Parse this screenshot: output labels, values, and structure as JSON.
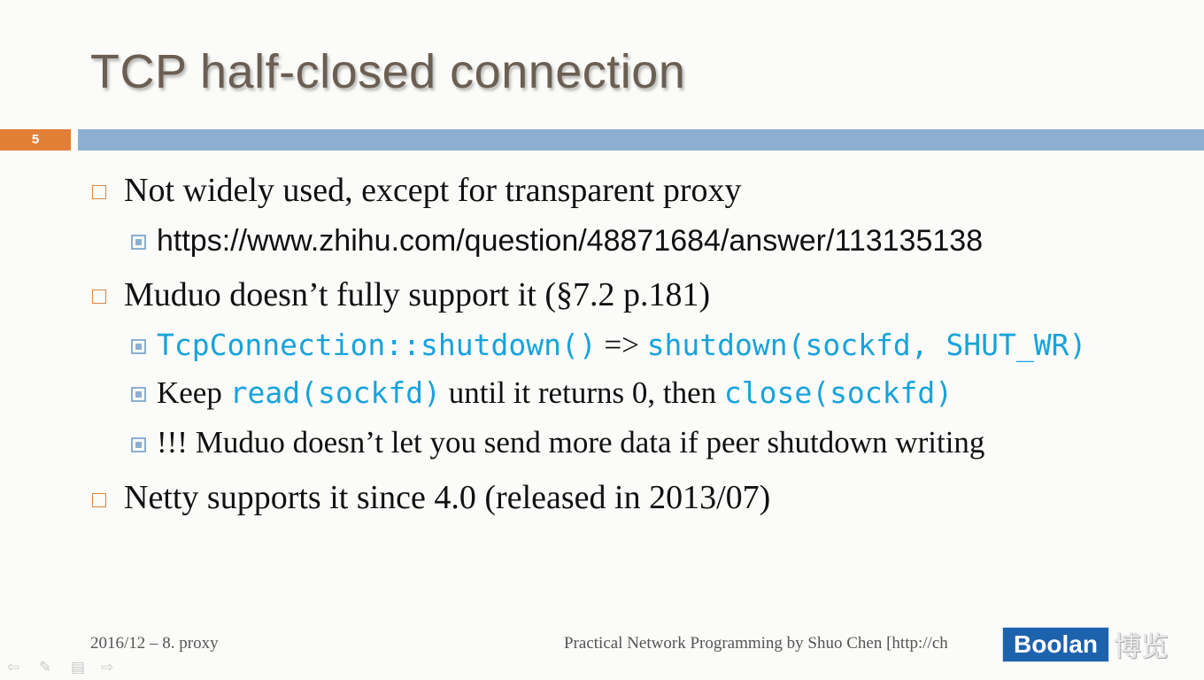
{
  "slide": {
    "title": "TCP half-closed connection",
    "number": "5"
  },
  "bullets": [
    {
      "text": "Not widely used, except for transparent proxy"
    },
    {
      "text": "https://www.zhihu.com/question/48871684/answer/113135138"
    },
    {
      "text": "Muduo doesn’t fully support it (§7.2 p.181)"
    },
    {
      "code1": "TcpConnection::shutdown()",
      "mid": " => ",
      "code2": "shutdown(sockfd, SHUT_WR)"
    },
    {
      "pre": "Keep ",
      "code1": "read(sockfd)",
      "mid": " until it returns 0, then ",
      "code2": "close(sockfd)"
    },
    {
      "text": "!!! Muduo doesn’t let you send more data if peer shutdown writing"
    },
    {
      "text": "Netty supports it since 4.0 (released in 2013/07)"
    }
  ],
  "footer": {
    "left": "2016/12 – 8. proxy",
    "right": "Practical Network Programming by Shuo Chen [http://ch",
    "logo_text": "Boolan",
    "logo_cn": "博览"
  },
  "icons": {
    "level1_bullet": "hollow-square-icon",
    "level2_bullet": "filled-square-icon",
    "nav": [
      "prev-arrow-icon",
      "pen-icon",
      "menu-icon",
      "next-arrow-icon"
    ]
  },
  "colors": {
    "title": "#6b5e52",
    "accent_orange": "#e27e36",
    "accent_blue": "#8cafd1",
    "code": "#17a3dc",
    "logo_bg": "#1d62ad"
  }
}
